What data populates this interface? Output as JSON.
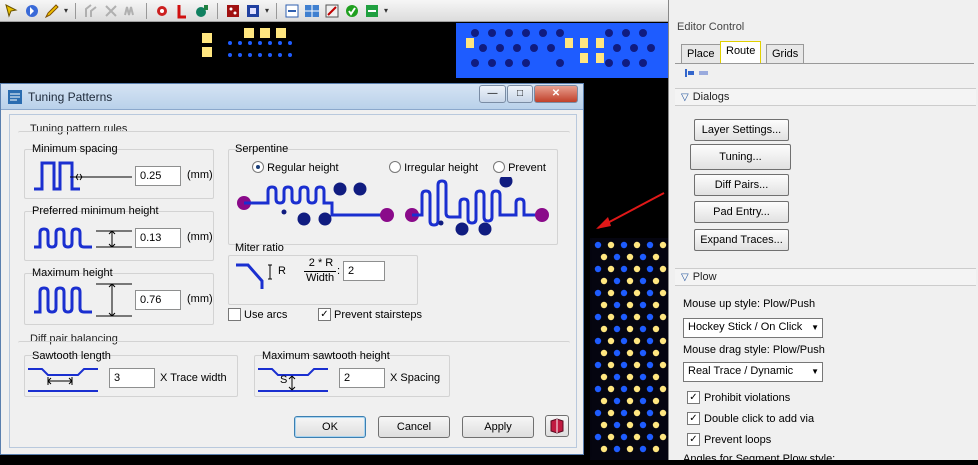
{
  "toolbar": {
    "icons": [
      "select-icon",
      "highlight-icon",
      "pencil-icon",
      "route-icon",
      "sketch-icon",
      "tune-icon",
      "gear-icon",
      "via-icon",
      "component-icon",
      "board-icon",
      "dropdown-icon",
      "copy-icon",
      "grid-icon",
      "edit-icon",
      "check-icon",
      "plow-icon"
    ]
  },
  "dialog": {
    "title": "Tuning Patterns",
    "rules_group": "Tuning pattern rules",
    "min_spacing_label": "Minimum spacing",
    "min_spacing_value": "0.25",
    "pref_min_height_label": "Preferred minimum height",
    "pref_min_height_value": "0.13",
    "max_height_label": "Maximum height",
    "max_height_value": "0.76",
    "unit": "(mm)",
    "serpentine_label": "Serpentine",
    "regular_height": "Regular height",
    "irregular_height": "Irregular height",
    "prevent": "Prevent",
    "miter_label": "Miter ratio",
    "miter_formula_top": "2 * R",
    "miter_formula_bottom": "Width",
    "miter_r": "R",
    "miter_value": "2",
    "use_arcs": "Use arcs",
    "prevent_stairsteps": "Prevent stairsteps",
    "diff_pair_group": "Diff pair balancing",
    "sawtooth_length_label": "Sawtooth length",
    "sawtooth_length_value": "3",
    "sawtooth_length_unit": "X Trace width",
    "max_sawtooth_label": "Maximum sawtooth height",
    "max_sawtooth_value": "2",
    "max_sawtooth_unit": "X Spacing",
    "s_label": "S",
    "ok": "OK",
    "cancel": "Cancel",
    "apply": "Apply"
  },
  "panel": {
    "title": "Editor Control",
    "tabs": [
      "Place",
      "Route",
      "Grids"
    ],
    "dialogs_section": "Dialogs",
    "buttons": [
      "Layer Settings...",
      "Tuning...",
      "Diff Pairs...",
      "Pad Entry...",
      "Expand Traces..."
    ],
    "plow_section": "Plow",
    "mouse_up_label": "Mouse up style: Plow/Push",
    "mouse_up_value": "Hockey Stick / On Click",
    "mouse_drag_label": "Mouse drag style: Plow/Push",
    "mouse_drag_value": "Real Trace / Dynamic",
    "checkboxes": [
      "Prohibit violations",
      "Double click to add via",
      "Prevent loops"
    ],
    "cut_label": "Angles for Segment Plow style:"
  },
  "colors": {
    "board_blue": "#1e5cff",
    "pad_yellow": "#ffe680",
    "trace_blue": "#1a2fd0",
    "via_navy": "#101c80",
    "pad_purple": "#8a0a8a",
    "highlight_yellow": "#ffff66",
    "arrow_red": "#e01818"
  }
}
